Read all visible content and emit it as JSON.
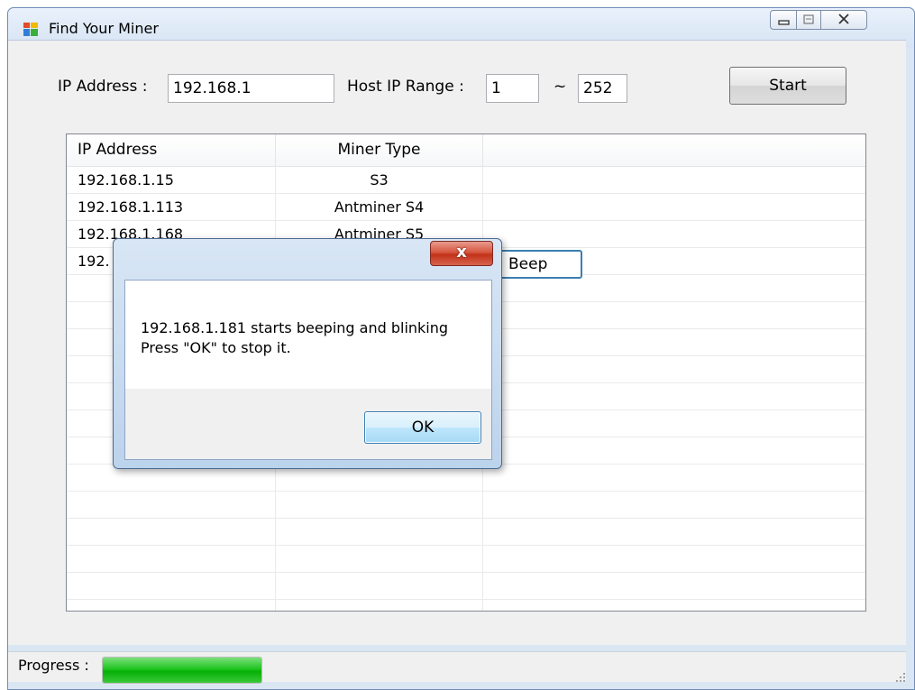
{
  "window": {
    "title": "Find Your Miner",
    "icon": "app-window-icon"
  },
  "toolbar": {
    "ip_label": "IP Address :",
    "ip_value": "192.168.1",
    "range_label": "Host IP Range :",
    "range_start": "1",
    "range_sep": "~",
    "range_end": "252",
    "start_label": "Start"
  },
  "grid": {
    "columns": [
      "IP Address",
      "Miner Type"
    ],
    "rows": [
      {
        "ip": "192.168.1.15",
        "type": "S3"
      },
      {
        "ip": "192.168.1.113",
        "type": "Antminer S4"
      },
      {
        "ip": "192.168.1.168",
        "type": "Antminer S5"
      },
      {
        "ip": "192.",
        "type": ""
      }
    ],
    "beep_label": "Beep"
  },
  "dialog": {
    "line1": "192.168.1.181 starts beeping and blinking",
    "line2": "Press \"OK\" to stop it.",
    "ok_label": "OK",
    "close_glyph": "x"
  },
  "status": {
    "progress_label": "Progress :",
    "progress_fraction": 1.0
  },
  "colors": {
    "accent": "#3c7fb1",
    "progress": "#06b006",
    "close": "#c2321a"
  }
}
